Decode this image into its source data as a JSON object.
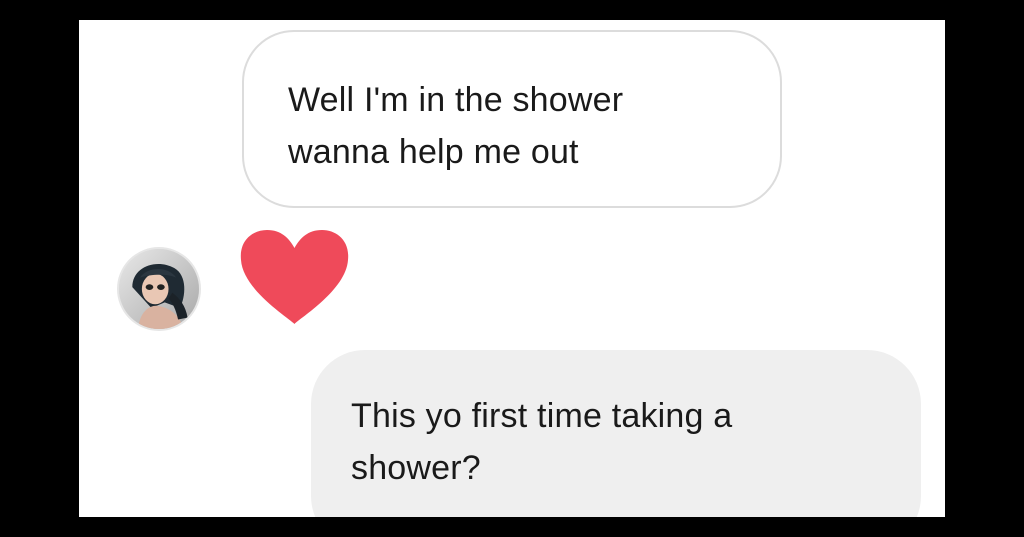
{
  "conversation": {
    "messages": [
      {
        "direction": "incoming",
        "text": "Well I'm in the shower\nwanna help me out"
      },
      {
        "direction": "reaction",
        "icon": "heart-icon",
        "color": "#ef4a5a"
      },
      {
        "direction": "outgoing",
        "text": "This yo first time taking a\nshower?"
      }
    ],
    "avatar": {
      "icon": "profile-photo-avatar"
    },
    "colors": {
      "incoming_bubble_border": "#dcdcdc",
      "outgoing_bubble_bg": "#efefef",
      "text": "#1a1a1a",
      "heart": "#ef4a5a"
    }
  }
}
